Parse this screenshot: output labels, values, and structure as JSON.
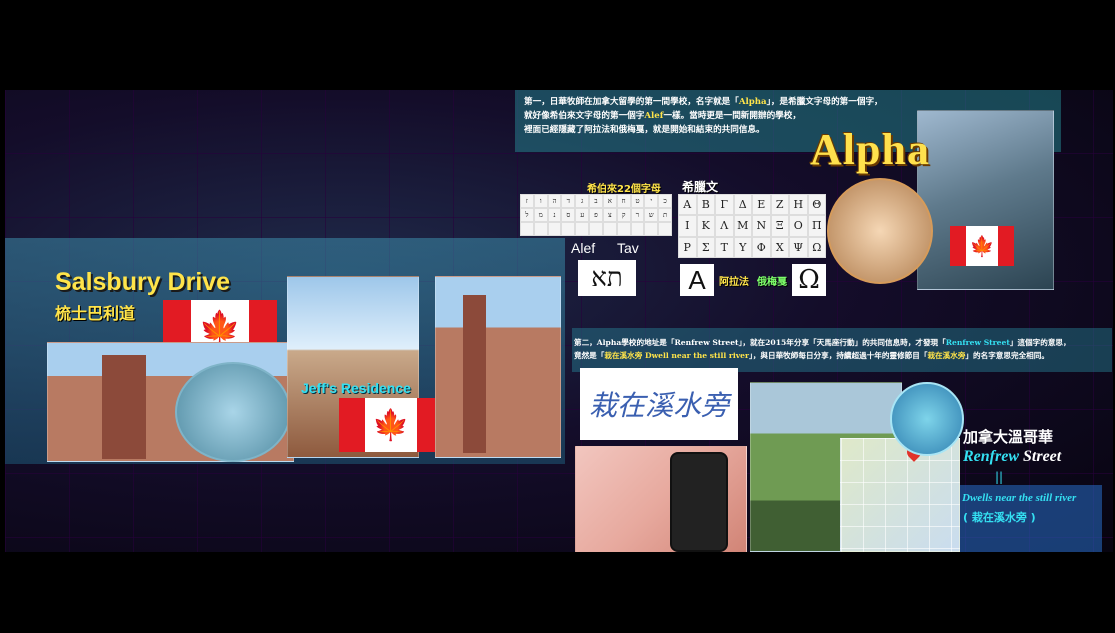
{
  "upper_text": {
    "line1_a": "第一，日華牧師在加拿大留學的第一間學校，名字就是「",
    "line1_hl": "Alpha",
    "line1_b": "」，是希臘文字母的第一個字，",
    "line2_a": "就好像希伯來文字母的第一個字",
    "line2_hl": "Alef",
    "line2_b": "一樣。當時更是一間新開辦的學校，",
    "line3": "裡面已經隱藏了阿拉法和俄梅戛，就是開始和結束的共同信息。"
  },
  "alpha_title": "Alpha",
  "hebrew_label": "希伯來22個字母",
  "greek_label": "希臘文",
  "greek_rows": [
    [
      "Α",
      "Β",
      "Γ",
      "Δ",
      "Ε",
      "Ζ",
      "Η",
      "Θ"
    ],
    [
      "Ι",
      "Κ",
      "Λ",
      "Μ",
      "Ν",
      "Ξ",
      "Ο",
      "Π"
    ],
    [
      "Ρ",
      "Σ",
      "Τ",
      "Υ",
      "Φ",
      "Χ",
      "Ψ",
      "Ω"
    ]
  ],
  "alef_label": "Alef",
  "tav_label": "Tav",
  "hebrew_glyphs": "תא",
  "alpha_glyph": "A",
  "omega_glyph": "Ω",
  "alpha_cn": "阿拉法",
  "omega_cn": "俄梅戛",
  "salsbury_title": "Salsbury Drive",
  "salsbury_cn": "梳士巴利道",
  "residence_label": "Jeff's Residence",
  "lower_text": {
    "line1_a": "第二，Alpha學校的地址是「Renfrew Street」，就在2015年分享「天馬座行動」的共同信息時，才發現「",
    "line1_hl": "Renfrew Street",
    "line1_b": "」這個字的意思，",
    "line2_a": "竟然是「",
    "line2_hl": "栽在溪水旁 Dwell near the still river",
    "line2_b": "」，與日華牧師每日分享，持續超過十年的靈修節目「",
    "line2_hl2": "栽在溪水旁",
    "line2_c": "」的名字意思完全相同。"
  },
  "calligraphy": "栽在溪水旁",
  "vancouver_cn": "加拿大溫哥華",
  "renfrew_italic": "Renfrew",
  "street_word": "Street",
  "equals_mark": "||",
  "dwells_text": "Dwells near the still river",
  "dwells_cn": "( 栽在溪水旁 )",
  "maple_icon": "🍁",
  "colors": {
    "accent_yellow": "#ffe44a",
    "accent_cyan": "#34e0f2",
    "flag_red": "#e21b23"
  }
}
